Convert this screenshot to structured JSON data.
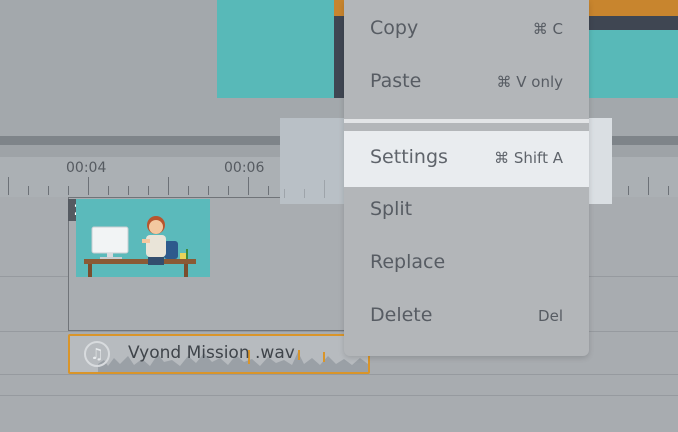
{
  "timeline": {
    "ruler_labels": [
      "00:04",
      "00:06"
    ],
    "video_clip": {
      "number": "2",
      "thumbnail": "office-worker-at-desk-illustration"
    },
    "audio_clip": {
      "icon": "music-note-icon",
      "label": "Vyond Mission .wav"
    }
  },
  "context_menu": {
    "items": [
      {
        "label": "Copy",
        "shortcut": "⌘ C"
      },
      {
        "label": "Paste",
        "shortcut": "⌘ V only"
      },
      {
        "label": "Settings",
        "shortcut": "⌘ Shift A",
        "highlighted": true
      },
      {
        "label": "Split",
        "shortcut": ""
      },
      {
        "label": "Replace",
        "shortcut": ""
      },
      {
        "label": "Delete",
        "shortcut": "Del"
      }
    ]
  },
  "colors": {
    "accent_orange": "#d9952a",
    "teal": "#58b9b8",
    "highlight": "#e9ecef"
  }
}
